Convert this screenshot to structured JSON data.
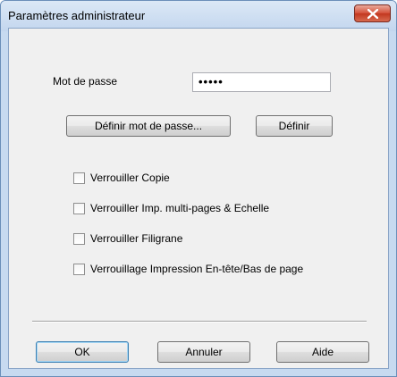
{
  "window": {
    "title": "Paramètres administrateur"
  },
  "password": {
    "label": "Mot de passe",
    "value": "•••••"
  },
  "buttons": {
    "define_password": "Définir mot de passe...",
    "define": "Définir",
    "ok": "OK",
    "cancel": "Annuler",
    "help": "Aide"
  },
  "checkboxes": [
    {
      "label": "Verrouiller Copie",
      "checked": false
    },
    {
      "label": "Verrouiller Imp. multi-pages & Echelle",
      "checked": false
    },
    {
      "label": "Verrouiller Filigrane",
      "checked": false
    },
    {
      "label": "Verrouillage Impression En-tête/Bas de page",
      "checked": false
    }
  ]
}
